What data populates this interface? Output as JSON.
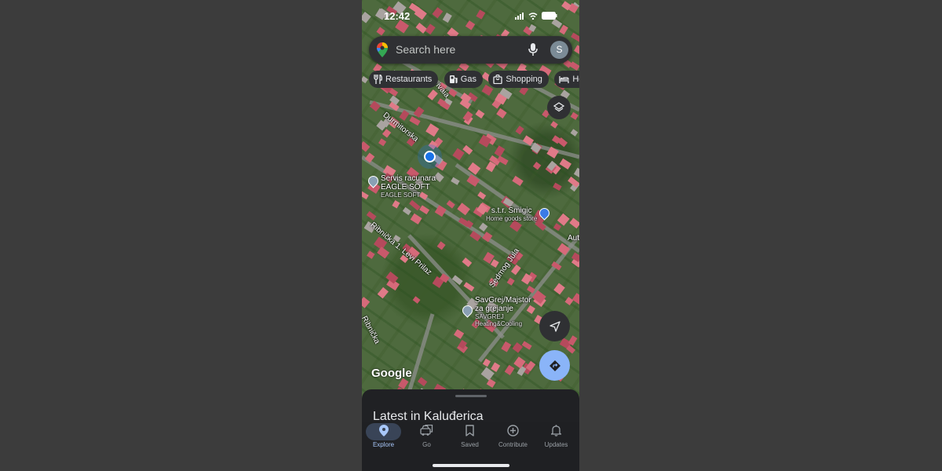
{
  "status_bar": {
    "time": "12:42"
  },
  "search": {
    "placeholder": "Search here",
    "avatar_initial": "S"
  },
  "chips": [
    {
      "label": "Restaurants",
      "icon": "fork-knife-icon"
    },
    {
      "label": "Gas",
      "icon": "gas-pump-icon"
    },
    {
      "label": "Shopping",
      "icon": "shopping-bag-icon"
    },
    {
      "label": "Hot",
      "icon": "bed-icon"
    }
  ],
  "map": {
    "streets": [
      "Durmitorska",
      "Ribnička 1. Levi Prilaz",
      "Sedmog Jula",
      "Ribnička",
      "ivaia",
      "Aut"
    ],
    "pois": [
      {
        "name": "Servis racunara EAGLE SOFT",
        "subtitle": "EAGLE SOFT"
      },
      {
        "name": "s.t.r. Smigic",
        "subtitle": "Home goods store"
      },
      {
        "name": "SavGrej/Majstor za grejanje",
        "subtitle": "SAVGREJ Heating&Cooling"
      }
    ],
    "logo": "Google"
  },
  "sheet": {
    "title": "Latest in Kaluđerica"
  },
  "nav": [
    {
      "label": "Explore",
      "icon": "location-pin-icon",
      "active": true
    },
    {
      "label": "Go",
      "icon": "car-icon",
      "active": false
    },
    {
      "label": "Saved",
      "icon": "bookmark-icon",
      "active": false
    },
    {
      "label": "Contribute",
      "icon": "plus-circle-icon",
      "active": false
    },
    {
      "label": "Updates",
      "icon": "bell-icon",
      "active": false
    }
  ],
  "colors": {
    "accent": "#8ab4f8",
    "active_pill": "#394457",
    "surface": "#2f3033"
  }
}
